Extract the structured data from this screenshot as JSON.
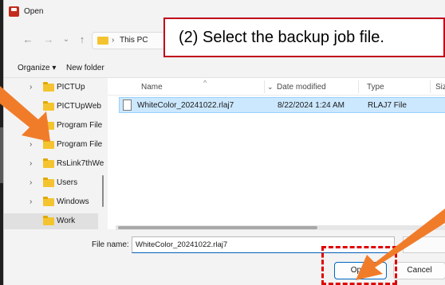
{
  "window": {
    "title": "Open"
  },
  "nav": {
    "back": "←",
    "forward": "→",
    "dropdown": "⌄",
    "up": "↑"
  },
  "address": {
    "separator": "›",
    "location": "This PC"
  },
  "callout": {
    "text": "(2) Select the backup job file."
  },
  "toolbar": {
    "organize": "Organize ▾",
    "new_folder": "New folder"
  },
  "sidebar": {
    "items": [
      {
        "chevron": "›",
        "label": "PICTUp"
      },
      {
        "chevron": "",
        "label": "PICTUpWeb"
      },
      {
        "chevron": "",
        "label": "Program File"
      },
      {
        "chevron": "›",
        "label": "Program File"
      },
      {
        "chevron": "›",
        "label": "RsLink7thWe"
      },
      {
        "chevron": "›",
        "label": "Users"
      },
      {
        "chevron": "›",
        "label": "Windows"
      },
      {
        "chevron": "",
        "label": "Work"
      }
    ]
  },
  "columns": {
    "name": "Name",
    "date": "Date modified",
    "type": "Type",
    "size": "Siz"
  },
  "files": [
    {
      "name": "WhiteColor_20241022.rlaj7",
      "date": "8/22/2024 1:24 AM",
      "type": "RLAJ7 File"
    }
  ],
  "bottom": {
    "file_name_label": "File name:",
    "file_name_value": "WhiteColor_20241022.rlaj7",
    "open_label": "Open",
    "cancel_label": "Cancel"
  },
  "colors": {
    "accent": "#0067c0",
    "highlight": "#e00000",
    "arrow": "#f07c2a",
    "selection": "#cce8ff"
  }
}
